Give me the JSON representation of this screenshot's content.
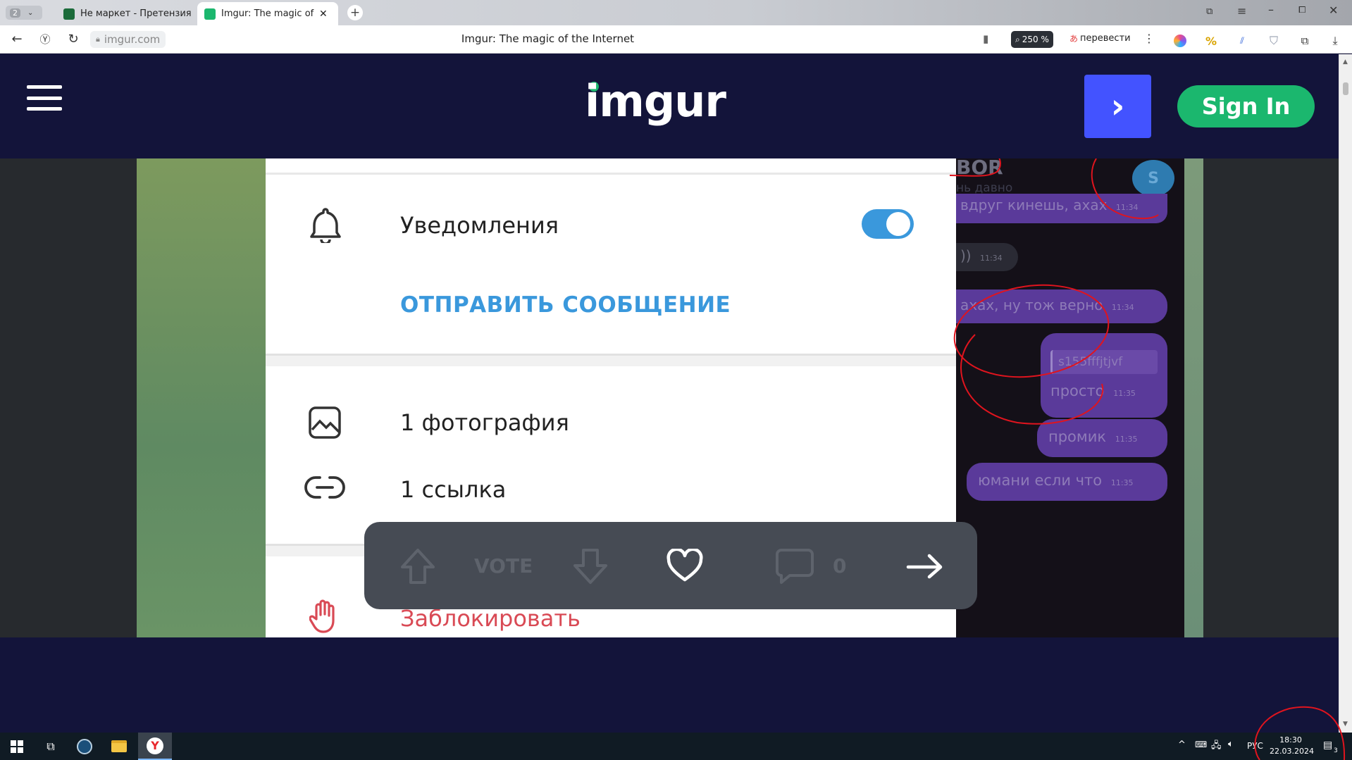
{
  "browser": {
    "tab_counter": "2",
    "tabs": [
      {
        "label": "Не маркет - Претензия к",
        "active": false,
        "favicon_color": "#1b6b3a"
      },
      {
        "label": "Imgur: The magic of the",
        "active": true,
        "favicon_color": "#1bb76e"
      }
    ],
    "url": "imgur.com",
    "page_title": "Imgur: The magic of the Internet",
    "zoom": "250 %",
    "translate_label": "перевести"
  },
  "imgur": {
    "logo_text": "imgur",
    "next_button_glyph": "›",
    "sign_in_label": "Sign In",
    "brand_colors": {
      "header_bg": "#13143a",
      "signin": "#1bb76e",
      "next": "#4353ff"
    }
  },
  "screenshot": {
    "notifications_label": "Уведомления",
    "send_message_label": "ОТПРАВИТЬ СООБЩЕНИЕ",
    "photos_label": "1 фотография",
    "links_label": "1 ссылка",
    "block_label": "Заблокировать",
    "chat_header_fragment": "BOR",
    "chat_subheader_fragment": "нь давно",
    "avatar_letter": "S",
    "messages": [
      {
        "text": "вдруг кинешь, ахах",
        "time": "11:34"
      },
      {
        "text": "))",
        "time": "11:34"
      },
      {
        "text": "ахах, ну тож верно",
        "time": "11:34"
      },
      {
        "text": "просто",
        "time": "11:35",
        "quote": "s155fffjtjvf"
      },
      {
        "text": "промик",
        "time": "11:35"
      },
      {
        "text": "юмани если что",
        "time": "11:35"
      }
    ]
  },
  "vote_bar": {
    "vote_label": "VOTE",
    "comment_count": "0"
  },
  "taskbar": {
    "language": "РУС",
    "time": "18:30",
    "date": "22.03.2024",
    "notification_count": "3"
  }
}
